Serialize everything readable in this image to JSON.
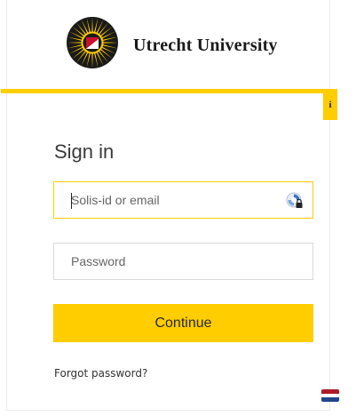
{
  "brand": {
    "name": "Utrecht University",
    "accent_color": "#ffcd00"
  },
  "info_tab": {
    "label": "i"
  },
  "form": {
    "title": "Sign in",
    "username": {
      "value": "",
      "placeholder": "Solis-id or email",
      "icon": "password-manager-icon"
    },
    "password": {
      "value": "",
      "placeholder": "Password"
    },
    "submit_label": "Continue",
    "forgot_label": "Forgot password?"
  },
  "language": {
    "icon": "flag-netherlands-icon",
    "colors": [
      "#ae1c28",
      "#ffffff",
      "#21468b"
    ]
  }
}
